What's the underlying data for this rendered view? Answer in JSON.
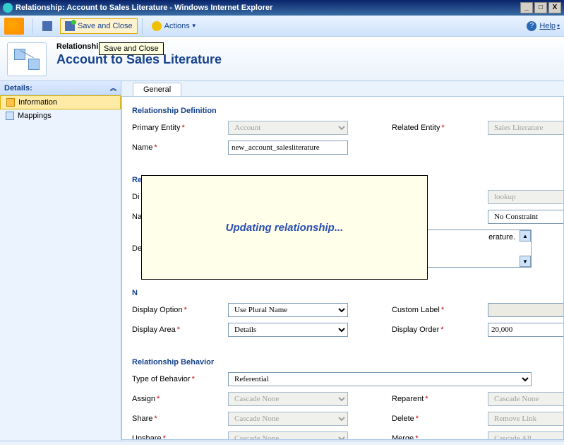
{
  "window": {
    "title": "Relationship: Account to Sales Literature - Windows Internet Explorer"
  },
  "toolbar": {
    "save_btn": "",
    "save_close": "Save and Close",
    "actions": "Actions",
    "help": "Help"
  },
  "tooltip": "Save and Close",
  "header": {
    "small": "Relationship",
    "big": "Account to Sales Literature"
  },
  "sidebar": {
    "title": "Details:",
    "items": [
      "Information",
      "Mappings"
    ]
  },
  "tabs": {
    "general": "General"
  },
  "sections": {
    "rel_def": "Relationship Definition",
    "rel_attr": "Relationship Attribute",
    "nav": "N",
    "rel_beh": "Relationship Behavior"
  },
  "labels": {
    "primary_entity": "Primary Entity",
    "related_entity": "Related Entity",
    "name": "Name",
    "di": "Di",
    "na": "Na",
    "de": "De",
    "display_option": "Display Option",
    "custom_label": "Custom Label",
    "display_area": "Display Area",
    "display_order": "Display Order",
    "type_behavior": "Type of Behavior",
    "assign": "Assign",
    "reparent": "Reparent",
    "share": "Share",
    "delete": "Delete",
    "unshare": "Unshare",
    "merge": "Merge"
  },
  "values": {
    "primary_entity": "Account",
    "related_entity": "Sales Literature",
    "name": "new_account_salesliterature",
    "attr_type": "lookup",
    "attr_constraint": "No Constraint",
    "desc_partial": "erature.",
    "display_option": "Use Plural Name",
    "display_area": "Details",
    "display_order": "20,000",
    "type_behavior": "Referential",
    "assign": "Cascade None",
    "reparent": "Cascade None",
    "share": "Cascade None",
    "delete": "Remove Link",
    "unshare": "Cascade None",
    "merge": "Cascade All"
  },
  "modal": {
    "text": "Updating relationship..."
  }
}
